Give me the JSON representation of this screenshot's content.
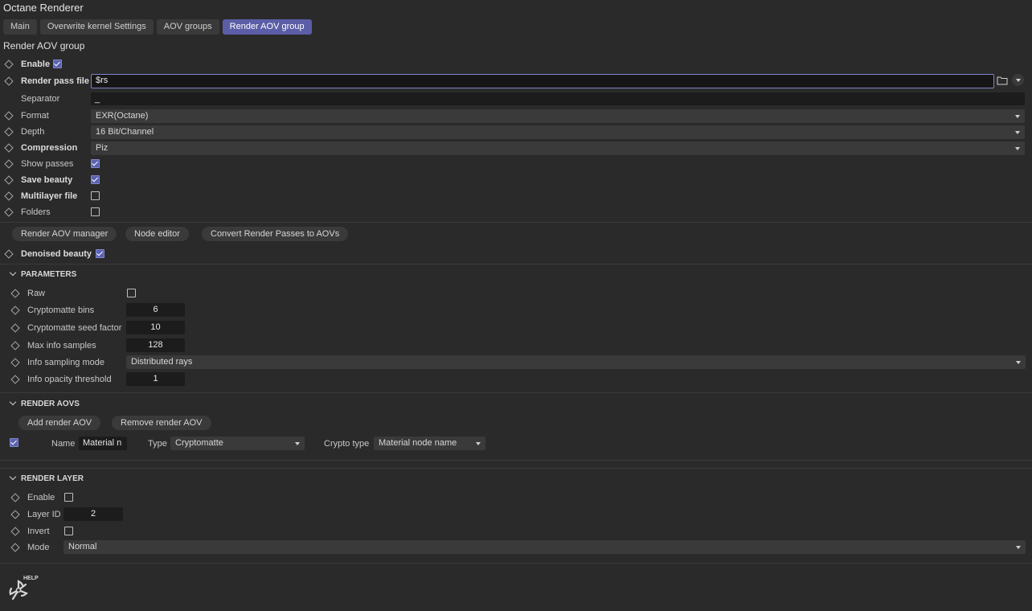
{
  "app": {
    "title": "Octane Renderer"
  },
  "tabs": [
    {
      "label": "Main"
    },
    {
      "label": "Overwrite kernel Settings"
    },
    {
      "label": "AOV groups"
    },
    {
      "label": "Render AOV group"
    }
  ],
  "section": {
    "title": "Render AOV group"
  },
  "fields": {
    "enable": {
      "label": "Enable",
      "checked": true
    },
    "render_pass_file": {
      "label": "Render pass file",
      "value": "$rs"
    },
    "separator": {
      "label": "Separator",
      "value": "_"
    },
    "format": {
      "label": "Format",
      "value": "EXR(Octane)"
    },
    "depth": {
      "label": "Depth",
      "value": "16 Bit/Channel"
    },
    "compression": {
      "label": "Compression",
      "value": "Piz"
    },
    "show_passes": {
      "label": "Show passes",
      "checked": true
    },
    "save_beauty": {
      "label": "Save beauty",
      "checked": true
    },
    "multilayer_file": {
      "label": "Multilayer file",
      "checked": false
    },
    "folders": {
      "label": "Folders",
      "checked": false
    }
  },
  "buttons": {
    "render_aov_manager": "Render AOV manager",
    "node_editor": "Node editor",
    "convert": "Convert Render Passes to AOVs"
  },
  "denoised_beauty": {
    "label": "Denoised beauty",
    "checked": true
  },
  "parameters": {
    "heading": "PARAMETERS",
    "raw": {
      "label": "Raw",
      "checked": false
    },
    "crypto_bins": {
      "label": "Cryptomatte bins",
      "value": "6"
    },
    "crypto_seed": {
      "label": "Cryptomatte seed factor",
      "value": "10"
    },
    "max_info_samples": {
      "label": "Max info samples",
      "value": "128"
    },
    "info_sampling_mode": {
      "label": "Info sampling mode",
      "value": "Distributed rays"
    },
    "info_opacity": {
      "label": "Info opacity threshold",
      "value": "1"
    }
  },
  "render_aovs": {
    "heading": "RENDER AOVS",
    "add": "Add render AOV",
    "remove": "Remove render AOV",
    "row": {
      "checked": true,
      "name_label": "Name",
      "name_value": "Material n",
      "type_label": "Type",
      "type_value": "Cryptomatte",
      "crypto_label": "Crypto type",
      "crypto_value": "Material node name"
    }
  },
  "render_layer": {
    "heading": "RENDER LAYER",
    "enable": {
      "label": "Enable",
      "checked": false
    },
    "layer_id": {
      "label": "Layer ID",
      "value": "2"
    },
    "invert": {
      "label": "Invert",
      "checked": false
    },
    "mode": {
      "label": "Mode",
      "value": "Normal"
    }
  },
  "help": {
    "label": "HELP",
    "icon": "octane-logo-icon"
  },
  "colors": {
    "accent": "#5b5ea6",
    "background": "#2a2a2a",
    "field": "#1c1c1c"
  }
}
